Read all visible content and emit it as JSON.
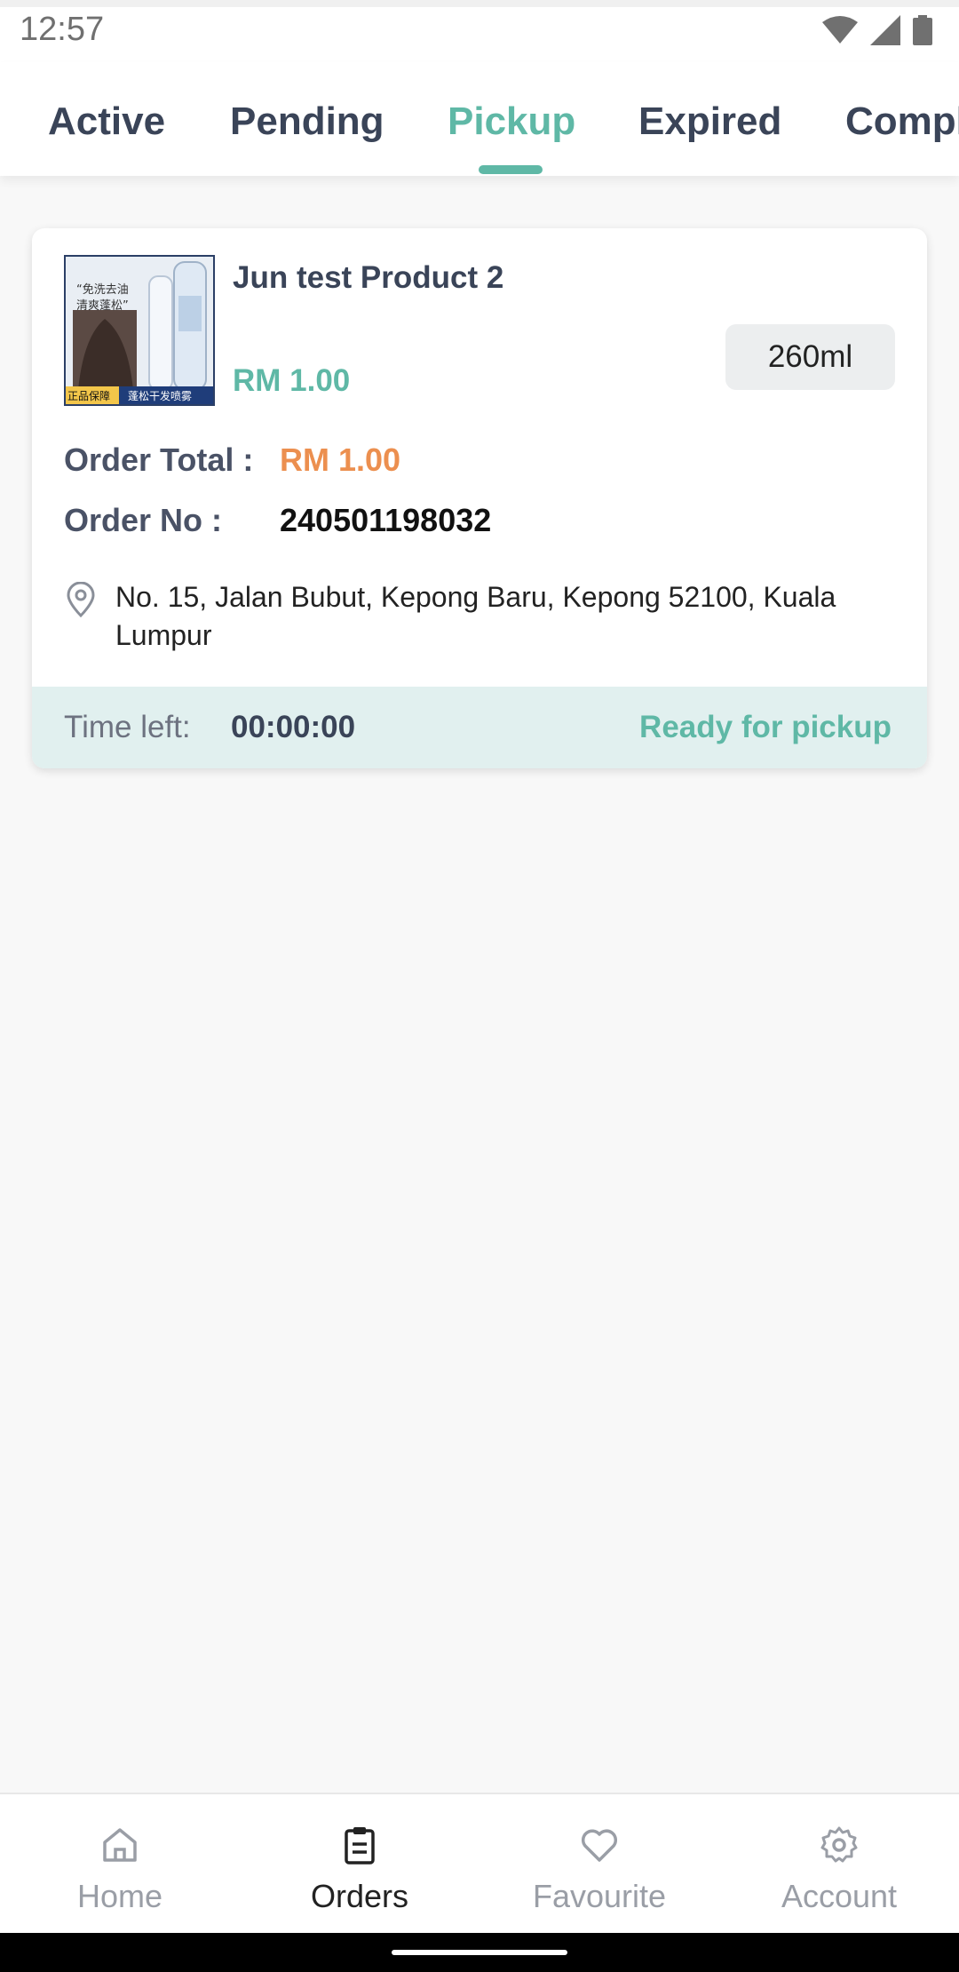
{
  "status_bar": {
    "time": "12:57"
  },
  "tabs": [
    {
      "label": "Active"
    },
    {
      "label": "Pending"
    },
    {
      "label": "Pickup"
    },
    {
      "label": "Expired"
    },
    {
      "label": "Completed"
    }
  ],
  "active_tab": "Pickup",
  "order": {
    "product_name": "Jun test Product 2",
    "product_price": "RM 1.00",
    "variant": "260ml",
    "thumbnail_text": {
      "line1": "“免洗去油",
      "line2": "清爽蓬松”",
      "badge_left": "正品保障",
      "badge_right": "蓬松干发喷雾"
    },
    "order_total_label": "Order Total :",
    "order_total_value": "RM 1.00",
    "order_no_label": "Order No :",
    "order_no_value": "240501198032",
    "address": "No. 15, Jalan Bubut, Kepong Baru, Kepong 52100, Kuala Lumpur",
    "time_left_label": "Time left:",
    "time_left_value": "00:00:00",
    "status": "Ready for pickup"
  },
  "bottom_nav": [
    {
      "label": "Home",
      "icon": "home-icon"
    },
    {
      "label": "Orders",
      "icon": "clipboard-icon"
    },
    {
      "label": "Favourite",
      "icon": "heart-icon"
    },
    {
      "label": "Account",
      "icon": "gear-icon"
    }
  ],
  "colors": {
    "accent": "#5fb8a6",
    "price_orange": "#ec8f4f",
    "footer_bg": "#e1f0ef",
    "text_dark": "#3a4458"
  }
}
